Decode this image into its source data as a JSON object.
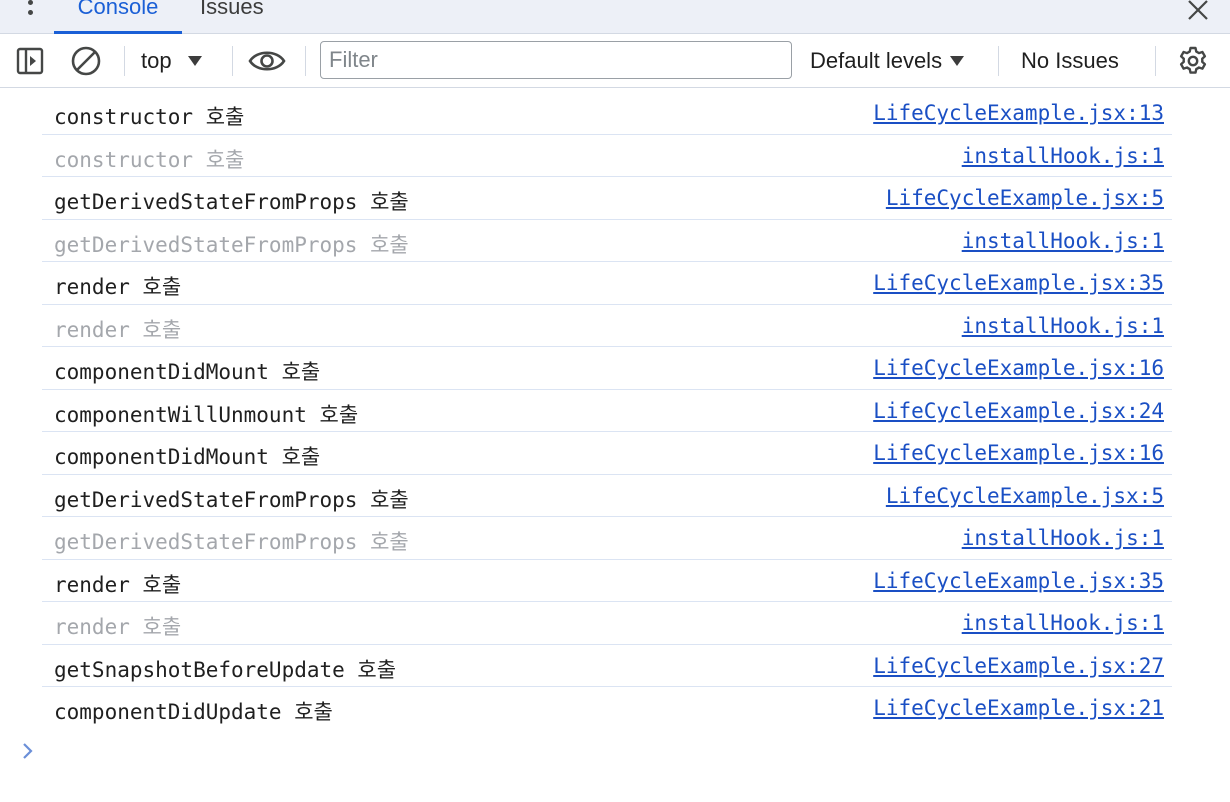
{
  "tabs": {
    "console_label": "Console",
    "issues_label": "Issues"
  },
  "toolbar": {
    "context_label": "top",
    "filter_placeholder": "Filter",
    "filter_value": "",
    "levels_label": "Default levels",
    "issues_status": "No Issues"
  },
  "icons": {
    "menu": "more-vertical-icon",
    "close": "close-icon",
    "sidebar": "sidebar-toggle-icon",
    "clear": "clear-console-icon",
    "eye": "live-expression-icon",
    "settings": "gear-icon",
    "prompt": "chevron-right-icon"
  },
  "colors": {
    "accent": "#1a5fd6",
    "link": "#1a4fc4",
    "dim_text": "#a4a7ac",
    "row_divider": "#dbe4f3"
  },
  "log": [
    {
      "message": "constructor 호출",
      "source": "LifeCycleExample.jsx:13",
      "dim": false
    },
    {
      "message": "constructor 호출",
      "source": "installHook.js:1",
      "dim": true
    },
    {
      "message": "getDerivedStateFromProps 호출",
      "source": "LifeCycleExample.jsx:5",
      "dim": false
    },
    {
      "message": "getDerivedStateFromProps 호출",
      "source": "installHook.js:1",
      "dim": true
    },
    {
      "message": "render 호출",
      "source": "LifeCycleExample.jsx:35",
      "dim": false
    },
    {
      "message": "render 호출",
      "source": "installHook.js:1",
      "dim": true
    },
    {
      "message": "componentDidMount 호출",
      "source": "LifeCycleExample.jsx:16",
      "dim": false
    },
    {
      "message": "componentWillUnmount 호출",
      "source": "LifeCycleExample.jsx:24",
      "dim": false
    },
    {
      "message": "componentDidMount 호출",
      "source": "LifeCycleExample.jsx:16",
      "dim": false
    },
    {
      "message": "getDerivedStateFromProps 호출",
      "source": "LifeCycleExample.jsx:5",
      "dim": false
    },
    {
      "message": "getDerivedStateFromProps 호출",
      "source": "installHook.js:1",
      "dim": true
    },
    {
      "message": "render 호출",
      "source": "LifeCycleExample.jsx:35",
      "dim": false
    },
    {
      "message": "render 호출",
      "source": "installHook.js:1",
      "dim": true
    },
    {
      "message": "getSnapshotBeforeUpdate 호출",
      "source": "LifeCycleExample.jsx:27",
      "dim": false
    },
    {
      "message": "componentDidUpdate 호출",
      "source": "LifeCycleExample.jsx:21",
      "dim": false
    }
  ]
}
